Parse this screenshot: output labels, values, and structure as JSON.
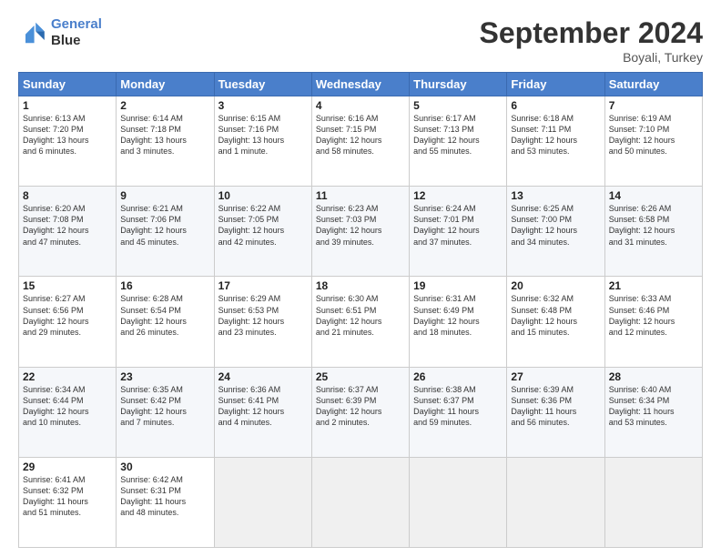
{
  "logo": {
    "line1": "General",
    "line2": "Blue"
  },
  "header": {
    "title": "September 2024",
    "location": "Boyali, Turkey"
  },
  "days_of_week": [
    "Sunday",
    "Monday",
    "Tuesday",
    "Wednesday",
    "Thursday",
    "Friday",
    "Saturday"
  ],
  "weeks": [
    [
      {
        "day": "1",
        "info": "Sunrise: 6:13 AM\nSunset: 7:20 PM\nDaylight: 13 hours\nand 6 minutes."
      },
      {
        "day": "2",
        "info": "Sunrise: 6:14 AM\nSunset: 7:18 PM\nDaylight: 13 hours\nand 3 minutes."
      },
      {
        "day": "3",
        "info": "Sunrise: 6:15 AM\nSunset: 7:16 PM\nDaylight: 13 hours\nand 1 minute."
      },
      {
        "day": "4",
        "info": "Sunrise: 6:16 AM\nSunset: 7:15 PM\nDaylight: 12 hours\nand 58 minutes."
      },
      {
        "day": "5",
        "info": "Sunrise: 6:17 AM\nSunset: 7:13 PM\nDaylight: 12 hours\nand 55 minutes."
      },
      {
        "day": "6",
        "info": "Sunrise: 6:18 AM\nSunset: 7:11 PM\nDaylight: 12 hours\nand 53 minutes."
      },
      {
        "day": "7",
        "info": "Sunrise: 6:19 AM\nSunset: 7:10 PM\nDaylight: 12 hours\nand 50 minutes."
      }
    ],
    [
      {
        "day": "8",
        "info": "Sunrise: 6:20 AM\nSunset: 7:08 PM\nDaylight: 12 hours\nand 47 minutes."
      },
      {
        "day": "9",
        "info": "Sunrise: 6:21 AM\nSunset: 7:06 PM\nDaylight: 12 hours\nand 45 minutes."
      },
      {
        "day": "10",
        "info": "Sunrise: 6:22 AM\nSunset: 7:05 PM\nDaylight: 12 hours\nand 42 minutes."
      },
      {
        "day": "11",
        "info": "Sunrise: 6:23 AM\nSunset: 7:03 PM\nDaylight: 12 hours\nand 39 minutes."
      },
      {
        "day": "12",
        "info": "Sunrise: 6:24 AM\nSunset: 7:01 PM\nDaylight: 12 hours\nand 37 minutes."
      },
      {
        "day": "13",
        "info": "Sunrise: 6:25 AM\nSunset: 7:00 PM\nDaylight: 12 hours\nand 34 minutes."
      },
      {
        "day": "14",
        "info": "Sunrise: 6:26 AM\nSunset: 6:58 PM\nDaylight: 12 hours\nand 31 minutes."
      }
    ],
    [
      {
        "day": "15",
        "info": "Sunrise: 6:27 AM\nSunset: 6:56 PM\nDaylight: 12 hours\nand 29 minutes."
      },
      {
        "day": "16",
        "info": "Sunrise: 6:28 AM\nSunset: 6:54 PM\nDaylight: 12 hours\nand 26 minutes."
      },
      {
        "day": "17",
        "info": "Sunrise: 6:29 AM\nSunset: 6:53 PM\nDaylight: 12 hours\nand 23 minutes."
      },
      {
        "day": "18",
        "info": "Sunrise: 6:30 AM\nSunset: 6:51 PM\nDaylight: 12 hours\nand 21 minutes."
      },
      {
        "day": "19",
        "info": "Sunrise: 6:31 AM\nSunset: 6:49 PM\nDaylight: 12 hours\nand 18 minutes."
      },
      {
        "day": "20",
        "info": "Sunrise: 6:32 AM\nSunset: 6:48 PM\nDaylight: 12 hours\nand 15 minutes."
      },
      {
        "day": "21",
        "info": "Sunrise: 6:33 AM\nSunset: 6:46 PM\nDaylight: 12 hours\nand 12 minutes."
      }
    ],
    [
      {
        "day": "22",
        "info": "Sunrise: 6:34 AM\nSunset: 6:44 PM\nDaylight: 12 hours\nand 10 minutes."
      },
      {
        "day": "23",
        "info": "Sunrise: 6:35 AM\nSunset: 6:42 PM\nDaylight: 12 hours\nand 7 minutes."
      },
      {
        "day": "24",
        "info": "Sunrise: 6:36 AM\nSunset: 6:41 PM\nDaylight: 12 hours\nand 4 minutes."
      },
      {
        "day": "25",
        "info": "Sunrise: 6:37 AM\nSunset: 6:39 PM\nDaylight: 12 hours\nand 2 minutes."
      },
      {
        "day": "26",
        "info": "Sunrise: 6:38 AM\nSunset: 6:37 PM\nDaylight: 11 hours\nand 59 minutes."
      },
      {
        "day": "27",
        "info": "Sunrise: 6:39 AM\nSunset: 6:36 PM\nDaylight: 11 hours\nand 56 minutes."
      },
      {
        "day": "28",
        "info": "Sunrise: 6:40 AM\nSunset: 6:34 PM\nDaylight: 11 hours\nand 53 minutes."
      }
    ],
    [
      {
        "day": "29",
        "info": "Sunrise: 6:41 AM\nSunset: 6:32 PM\nDaylight: 11 hours\nand 51 minutes."
      },
      {
        "day": "30",
        "info": "Sunrise: 6:42 AM\nSunset: 6:31 PM\nDaylight: 11 hours\nand 48 minutes."
      },
      {
        "day": "",
        "info": ""
      },
      {
        "day": "",
        "info": ""
      },
      {
        "day": "",
        "info": ""
      },
      {
        "day": "",
        "info": ""
      },
      {
        "day": "",
        "info": ""
      }
    ]
  ]
}
